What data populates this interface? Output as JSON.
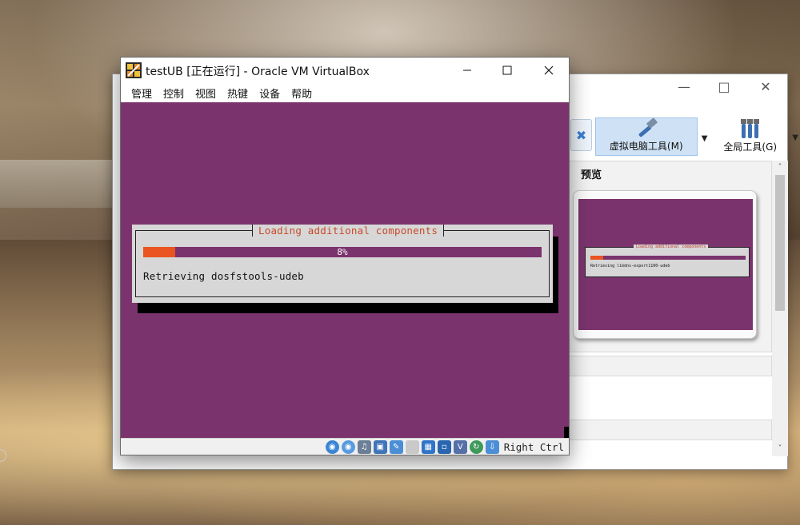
{
  "vm_window": {
    "title": "testUB [正在运行] - Oracle VM VirtualBox",
    "menu": [
      "管理",
      "控制",
      "视图",
      "热键",
      "设备",
      "帮助"
    ],
    "installer": {
      "dialog_title": "Loading additional components",
      "progress_percent": 8,
      "progress_label": "8%",
      "status_text": "Retrieving dosfstools-udeb"
    },
    "statusbar": {
      "icons": [
        "hard-disk-icon",
        "optical-drive-icon",
        "audio-icon",
        "network-icon",
        "usb-icon",
        "shared-folders-icon",
        "display-icon",
        "video-capture-icon",
        "cpu-virtualization-icon",
        "mouse-integration-icon",
        "keyboard-capture-icon"
      ],
      "host_key": "Right Ctrl"
    }
  },
  "manager_window": {
    "toolbar": {
      "machine_tools_label": "虚拟电脑工具(M)",
      "global_tools_label": "全局工具(G)"
    },
    "preview_title": "预览",
    "preview": {
      "dialog_title": "Loading additional components",
      "progress_label": "8%",
      "status_text": "Retrieving libdns-export1100-udeb"
    }
  },
  "colors": {
    "ubuntu_purple": "#7b336e",
    "ubuntu_orange": "#e95420",
    "dialog_gray": "#d7d7d7"
  }
}
